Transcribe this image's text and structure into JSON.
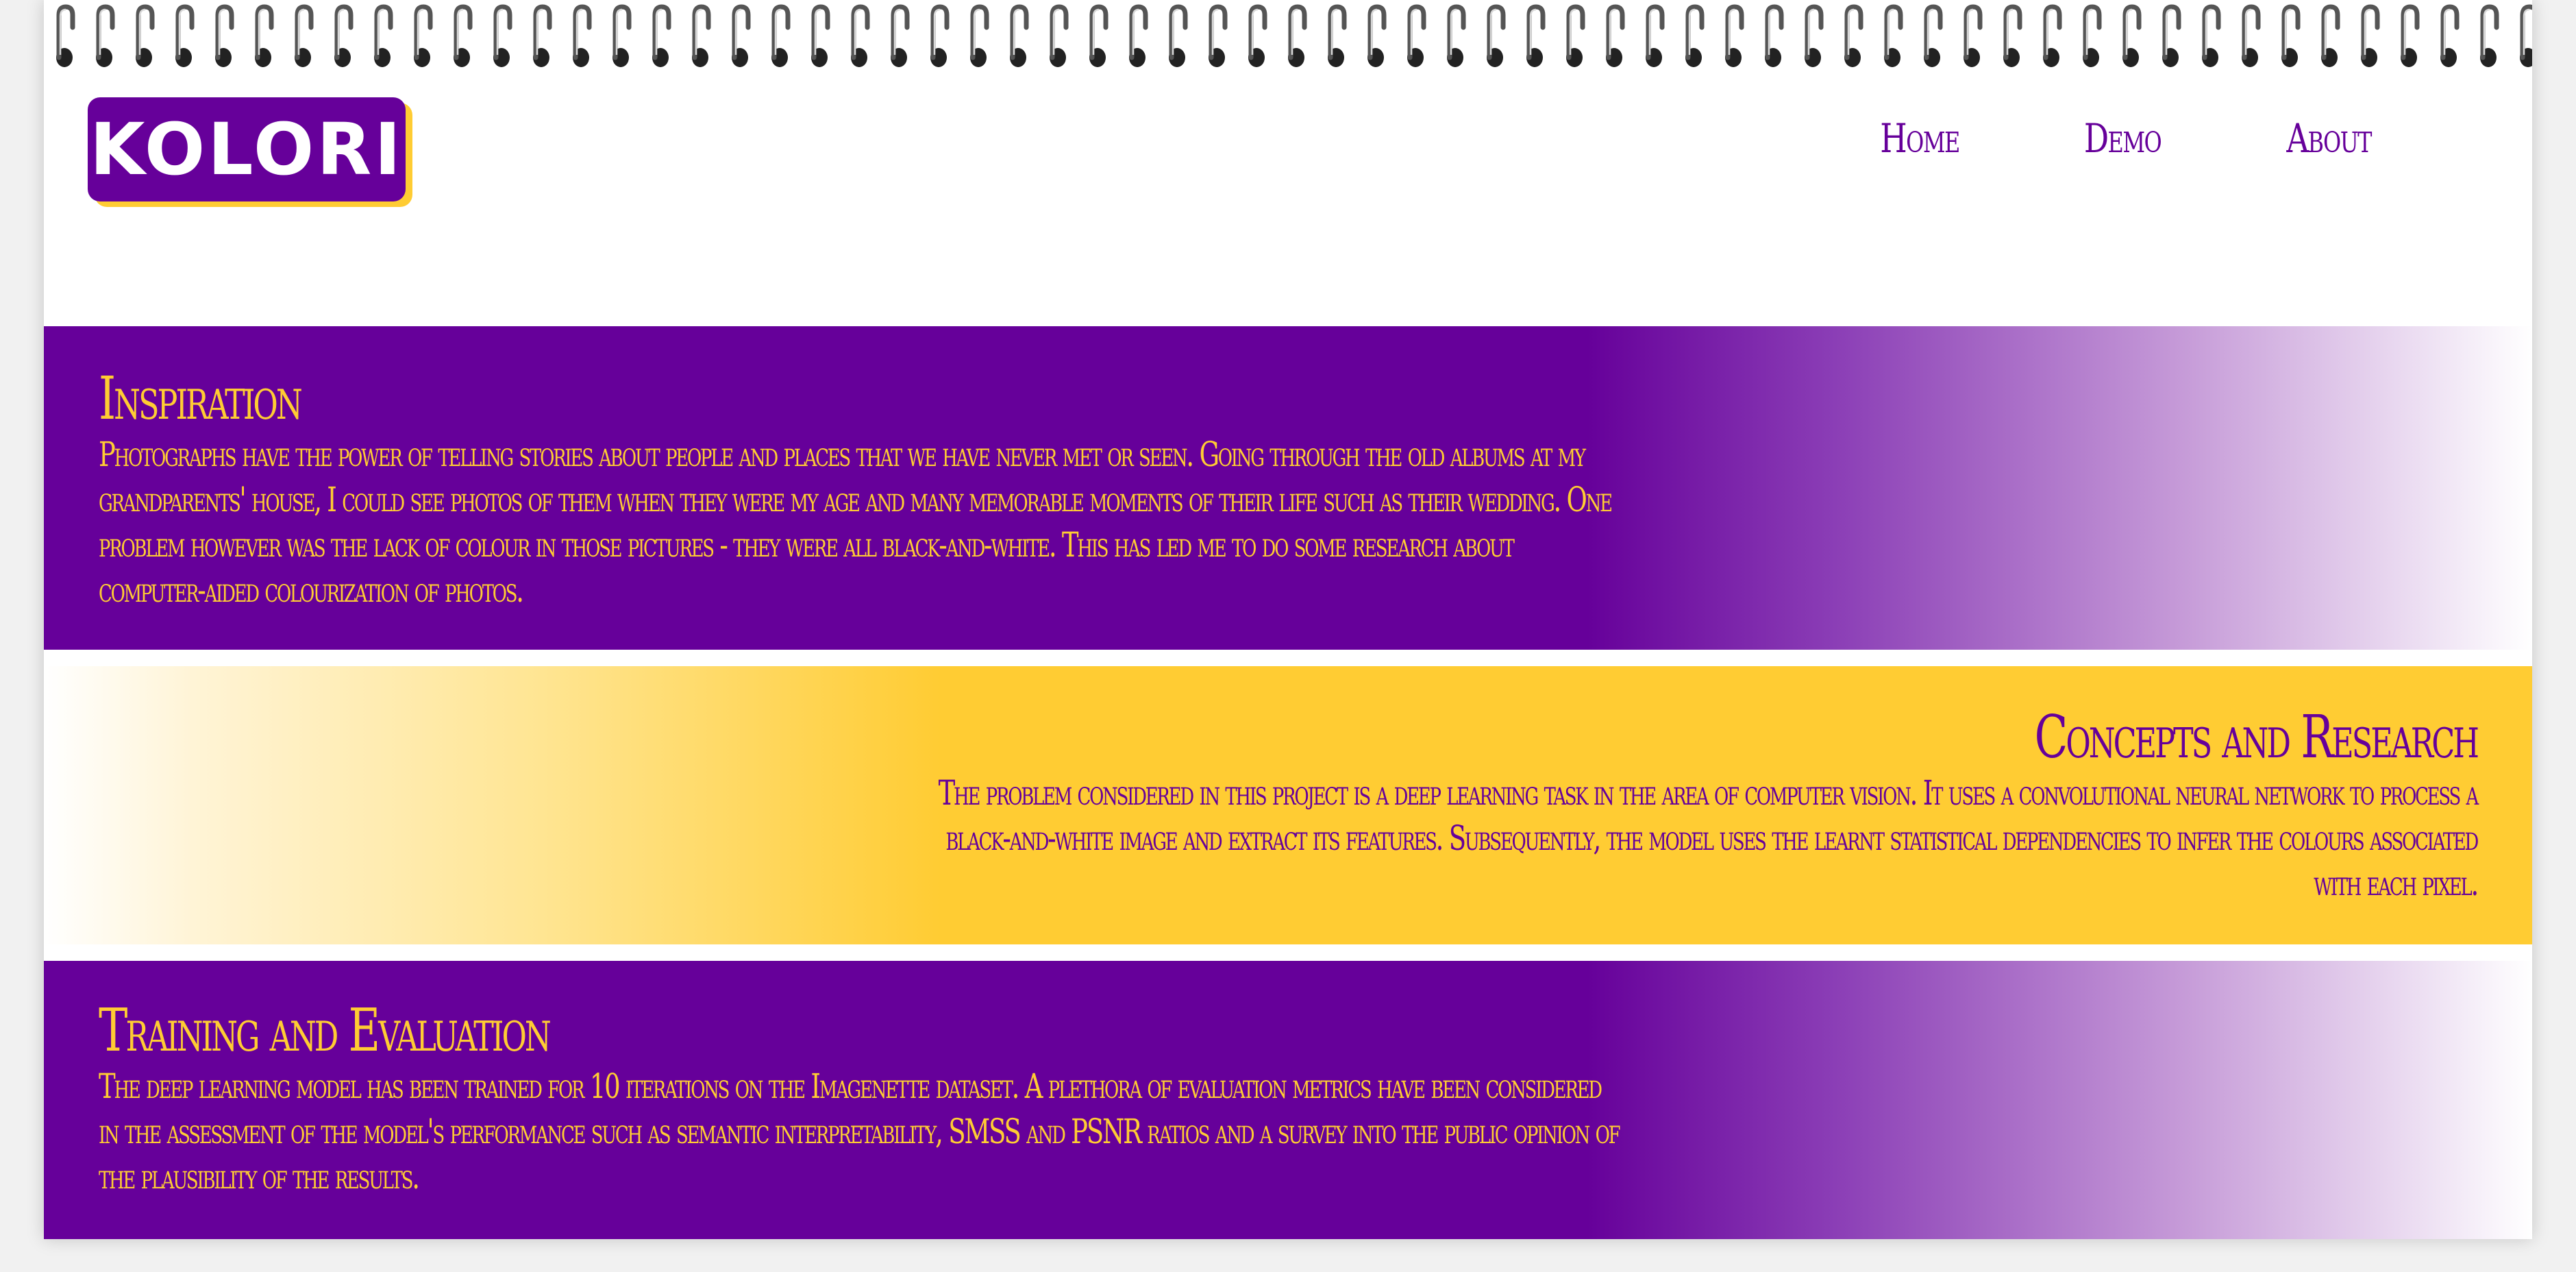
{
  "brand": {
    "logo_text": "KOLORI",
    "colors": {
      "purple": "#66009a",
      "yellow": "#ffcc33"
    }
  },
  "nav": {
    "items": [
      {
        "label": "Home"
      },
      {
        "label": "Demo"
      },
      {
        "label": "About"
      }
    ]
  },
  "sections": [
    {
      "title": "Inspiration",
      "body": "Photographs have the power of telling stories about people and places that we have never met or seen. Going through the old albums at my grandparents' house, I could see photos of them when they were my age and many memorable moments of their life such as their wedding. One problem however was the lack of colour in those pictures - they were all black-and-white. This has led me to do some research about computer-aided colourization of photos."
    },
    {
      "title": "Concepts and Research",
      "body": "The problem considered in this project is a deep learning task in the area of computer vision. It uses a convolutional neural network to process a black-and-white image and extract its features. Subsequently, the model uses the learnt statistical dependencies to infer the colours associated with each pixel."
    },
    {
      "title": "Training and Evaluation",
      "body": "The deep learning model has been trained for 10 iterations on the Imagenette dataset. A plethora of evaluation metrics have been considered in the assessment of the model's performance such as semantic interpretability, SMSS and PSNR ratios and a survey into the public opinion of the plausibility of the results."
    }
  ]
}
